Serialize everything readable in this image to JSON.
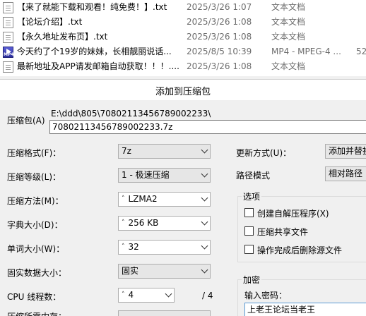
{
  "files": [
    {
      "name": "【来了就能下载和观看！纯免费！】.txt",
      "date": "2025/3/26 1:07",
      "type": "文本文档",
      "size": "",
      "icon": "text-file-icon"
    },
    {
      "name": "【论坛介绍】.txt",
      "date": "2025/3/26 1:08",
      "type": "文本文档",
      "size": "",
      "icon": "text-file-icon"
    },
    {
      "name": "【永久地址发布页】.txt",
      "date": "2025/3/26 1:08",
      "type": "文本文档",
      "size": "",
      "icon": "text-file-icon"
    },
    {
      "name": "今天约了个19岁的妹妹，长相靓丽说话...",
      "date": "2025/8/5 10:39",
      "type": "MP4 - MPEG-4 ...",
      "size": "52",
      "icon": "mp4-file-icon"
    },
    {
      "name": "最新地址及APP请发邮箱自动获取！！！....",
      "date": "2025/3/26 1:08",
      "type": "文本文档",
      "size": "",
      "icon": "text-file-icon"
    }
  ],
  "dialog": {
    "title": "添加到压缩包",
    "archive": {
      "label": "压缩包(A)",
      "folder": "E:\\ddd\\805\\70802113456789002233\\",
      "filename": "70802113456789002233.7z"
    },
    "format": {
      "label": "压缩格式(F)：",
      "value": "7z"
    },
    "level": {
      "label": "压缩等级(L)：",
      "value": "1 - 极速压缩"
    },
    "method": {
      "label": "压缩方法(M)：",
      "value": "LZMA2"
    },
    "dict": {
      "label": "字典大小(D)：",
      "value": "256 KB"
    },
    "word": {
      "label": "单词大小(W)：",
      "value": "32"
    },
    "solid": {
      "label": "固实数据大小：",
      "value": "固实"
    },
    "cpu": {
      "label": "CPU 线程数：",
      "value": "4",
      "total": "/ 4"
    },
    "memory": {
      "label": "压缩所需内存："
    },
    "update": {
      "label": "更新方式(U)：",
      "value": "添加并替换"
    },
    "path": {
      "label": "路径模式",
      "value": "相对路径"
    },
    "options": {
      "title": "选项",
      "items": [
        {
          "label": "创建自解压程序(X)",
          "checked": false
        },
        {
          "label": "压缩共享文件",
          "checked": false
        },
        {
          "label": "操作完成后删除源文件",
          "checked": false
        }
      ]
    },
    "encryption": {
      "title": "加密",
      "password_label": "输入密码：",
      "password_value": "上老王论坛当老王"
    }
  }
}
